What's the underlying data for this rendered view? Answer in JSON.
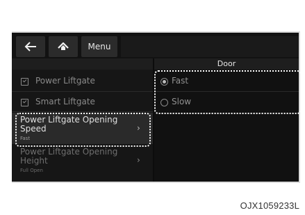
{
  "nav": {
    "back_icon": "arrow-left-icon",
    "home_icon": "home-icon",
    "menu_label": "Menu"
  },
  "left_menu": {
    "items": [
      {
        "label": "Power Liftgate",
        "checked": true
      },
      {
        "label": "Smart Liftgate",
        "checked": true
      }
    ],
    "submenus": [
      {
        "title_line1": "Power Liftgate Opening",
        "title_line2": "Speed",
        "value": "Fast",
        "selected": true
      },
      {
        "title_line1": "Power Liftgate Opening",
        "title_line2": "Height",
        "value": "Full Open",
        "selected": false
      }
    ]
  },
  "right_panel": {
    "header": "Door",
    "options": [
      {
        "label": "Fast",
        "selected": true
      },
      {
        "label": "Slow",
        "selected": false
      }
    ]
  },
  "caption": "OJX1059233L",
  "colors": {
    "background": "#0c0c0c",
    "highlight_border": "#ffffff"
  }
}
